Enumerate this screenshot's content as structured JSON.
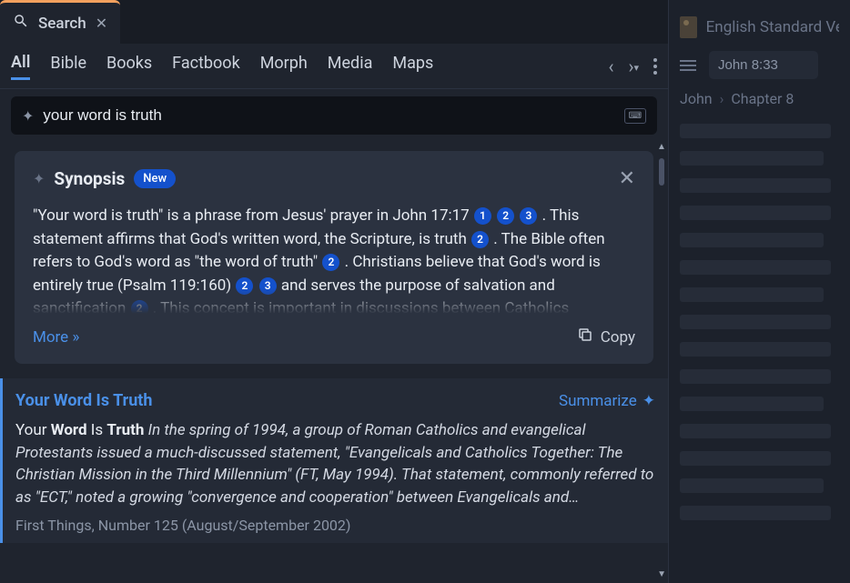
{
  "tab": {
    "title": "Search"
  },
  "filters": {
    "items": [
      "All",
      "Bible",
      "Books",
      "Factbook",
      "Morph",
      "Media",
      "Maps"
    ],
    "active_index": 0
  },
  "search": {
    "query": "your word is truth"
  },
  "synopsis": {
    "title": "Synopsis",
    "badge": "New",
    "text_parts": {
      "p1": "\"Your word is truth\" is a phrase from Jesus' prayer in John 17:17 ",
      "p2": " . This statement affirms that God's written word, the Scripture, is truth ",
      "p3": " . The Bible often refers to God's word as \"the word of truth\" ",
      "p4": " . Christians believe that God's word is entirely true (Psalm 119:160) ",
      "p5": "  and serves the purpose of salvation and sanctification ",
      "p6": " . This concept is important in discussions between Catholics"
    },
    "more": "More »",
    "copy": "Copy"
  },
  "result": {
    "title": "Your Word Is Truth",
    "summarize": "Summarize",
    "lead_your": "Your ",
    "lead_word": "Word",
    "lead_is": " Is ",
    "lead_truth": "Truth",
    "excerpt": " In the spring of 1994, a group of Roman Catholics and evangelical Protestants issued a much-discussed statement, \"Evangelicals and Catholics Together: The Christian Mission in the Third Millennium\" (FT, May 1994). That statement, commonly referred to as \"ECT,\" noted a growing \"convergence and cooperation\" between Evangelicals and…",
    "source": "First Things, Number 125 (August/September 2002)"
  },
  "right": {
    "title": "English Standard Ver",
    "reference": "John 8:33",
    "crumb_book": "John",
    "crumb_chapter": "Chapter 8"
  },
  "refs": {
    "r1": "1",
    "r2": "2",
    "r3": "3"
  }
}
